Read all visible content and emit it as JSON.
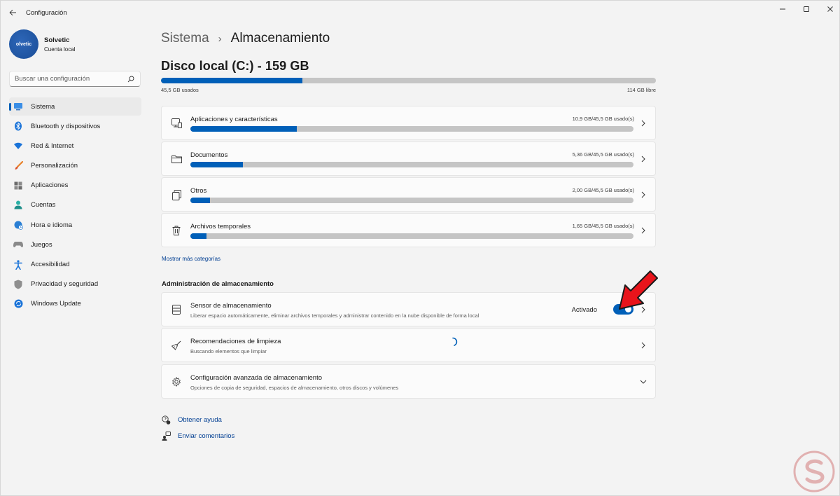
{
  "window": {
    "title": "Configuración"
  },
  "profile": {
    "name": "Solvetic",
    "subtitle": "Cuenta local",
    "avatar_text": "olvetic"
  },
  "search": {
    "placeholder": "Buscar una configuración"
  },
  "sidebar": {
    "items": [
      {
        "label": "Sistema",
        "icon": "monitor-icon",
        "active": true
      },
      {
        "label": "Bluetooth y dispositivos",
        "icon": "bluetooth-icon"
      },
      {
        "label": "Red & Internet",
        "icon": "wifi-icon"
      },
      {
        "label": "Personalización",
        "icon": "brush-icon"
      },
      {
        "label": "Aplicaciones",
        "icon": "apps-icon"
      },
      {
        "label": "Cuentas",
        "icon": "person-icon"
      },
      {
        "label": "Hora e idioma",
        "icon": "globe-clock-icon"
      },
      {
        "label": "Juegos",
        "icon": "gamepad-icon"
      },
      {
        "label": "Accesibilidad",
        "icon": "accessibility-icon"
      },
      {
        "label": "Privacidad y seguridad",
        "icon": "shield-icon"
      },
      {
        "label": "Windows Update",
        "icon": "update-icon"
      }
    ]
  },
  "breadcrumb": {
    "parent": "Sistema",
    "separator": "›",
    "current": "Almacenamiento"
  },
  "disk": {
    "title": "Disco local (C:) - 159 GB",
    "used_label": "45,5 GB usados",
    "free_label": "114 GB libre",
    "used_fraction": 0.286
  },
  "categories": [
    {
      "label": "Aplicaciones y características",
      "value": "10,9 GB/45,5 GB usado(s)",
      "fraction": 0.24,
      "icon": "apps-list-icon"
    },
    {
      "label": "Documentos",
      "value": "5,36 GB/45,5 GB usado(s)",
      "fraction": 0.118,
      "icon": "folder-icon"
    },
    {
      "label": "Otros",
      "value": "2,00 GB/45,5 GB usado(s)",
      "fraction": 0.044,
      "icon": "documents-icon"
    },
    {
      "label": "Archivos temporales",
      "value": "1,65 GB/45,5 GB usado(s)",
      "fraction": 0.036,
      "icon": "trash-icon"
    }
  ],
  "more_categories": "Mostrar más categorías",
  "management": {
    "section_title": "Administración de almacenamiento",
    "sensor": {
      "title": "Sensor de almacenamiento",
      "description": "Liberar espacio automáticamente, eliminar archivos temporales y administrar contenido en la nube disponible de forma local",
      "toggle_label": "Activado",
      "toggle_on": true
    },
    "cleanup": {
      "title": "Recomendaciones de limpieza",
      "description": "Buscando elementos que limpiar"
    },
    "advanced": {
      "title": "Configuración avanzada de almacenamiento",
      "description": "Opciones de copia de seguridad, espacios de almacenamiento, otros discos y volúmenes"
    }
  },
  "help": {
    "get_help": "Obtener ayuda",
    "feedback": "Enviar comentarios"
  },
  "colors": {
    "accent": "#005fb8",
    "bar_bg": "#c5c5c5",
    "link": "#003e92",
    "annotation_arrow": "#e8141b"
  }
}
